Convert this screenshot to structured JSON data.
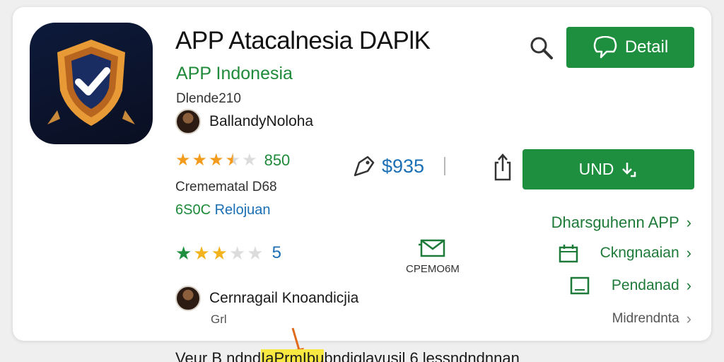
{
  "app": {
    "title": "APP Atacalnesia DAPlK",
    "subtitle": "APP Indonesia",
    "version": "Dlende210",
    "developer": "BallandyNoloha"
  },
  "buttons": {
    "detail_label": "Detail",
    "und_label": "UND"
  },
  "rating": {
    "value": "850",
    "stars_filled": 3.5,
    "caption": "Cremematal D68",
    "release_code": "6S0C",
    "release_text": "Relojuan"
  },
  "price": "$935",
  "rating2": {
    "value": "5",
    "stars_filled": 3
  },
  "cpe_label": "CPEMO6M",
  "links": [
    {
      "label": "Dharsguhenn APP"
    },
    {
      "label": "Ckngnaaian"
    },
    {
      "label": "Pendanad"
    },
    {
      "label": "Midrendnta"
    }
  ],
  "review": {
    "name": "Cernragail Knoandicjia",
    "sub": "Grl"
  },
  "footer": {
    "pre": "Veur B ndnd",
    "highlight": "IaPrmIbu",
    "post": "bndiglavusil 6 lessndndnnan"
  },
  "colors": {
    "green": "#1e8f3e",
    "blue": "#1b6fb5",
    "star_orange": "#f29b1d",
    "star_green": "#1e8f3e"
  },
  "icons": {
    "app": "shield-check-icon",
    "search": "search-icon",
    "detail": "chat-bubble-icon",
    "share": "share-icon",
    "download": "download-icon",
    "price": "tag-icon",
    "cpe": "email-icon"
  }
}
